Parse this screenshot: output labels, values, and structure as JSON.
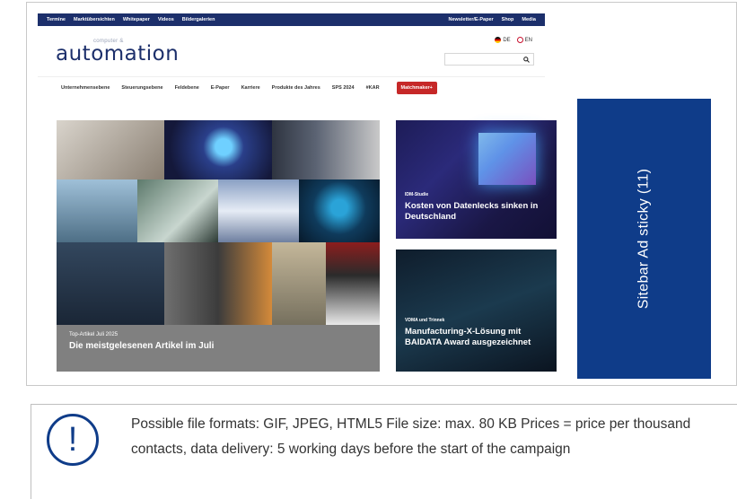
{
  "site": {
    "topbar_left": [
      "Termine",
      "Marktübersichten",
      "Whitepaper",
      "Videos",
      "Bildergalerien"
    ],
    "topbar_right": [
      "Newsletter/E-Paper",
      "Shop",
      "Media"
    ],
    "logo_small": "computer &",
    "logo_main": "automation",
    "lang_de": "DE",
    "lang_en": "EN",
    "search_icon": "search-icon",
    "nav": [
      "Unternehmensebene",
      "Steuerungsebene",
      "Feldebene",
      "E-Paper",
      "Karriere",
      "Produkte des Jahres",
      "SPS 2024",
      "#KAR"
    ],
    "nav_cta": "Matchmaker+",
    "main_overlay": {
      "kicker": "Top-Artikel Juli 2025",
      "headline": "Die meistgelesenen Artikel im Juli"
    },
    "card1": {
      "kicker": "IDM-Studie",
      "headline": "Kosten von Datenlecks sinken in Deutschland"
    },
    "card2": {
      "kicker": "VDMA und Trinnek",
      "headline": "Manufacturing-X-Lösung mit BAIDATA Award ausgezeichnet"
    },
    "colors": {
      "navy": "#1c2f6b",
      "red": "#c62828",
      "ad_blue": "#0f3c89"
    }
  },
  "ad": {
    "label": "Sitebar Ad sticky (11)"
  },
  "note": {
    "icon": "exclamation-icon",
    "text": "Possible file formats: GIF, JPEG, HTML5 File size: max. 80 KB Prices = price per thousand contacts, data delivery: 5 working days before the start of the campaign"
  }
}
